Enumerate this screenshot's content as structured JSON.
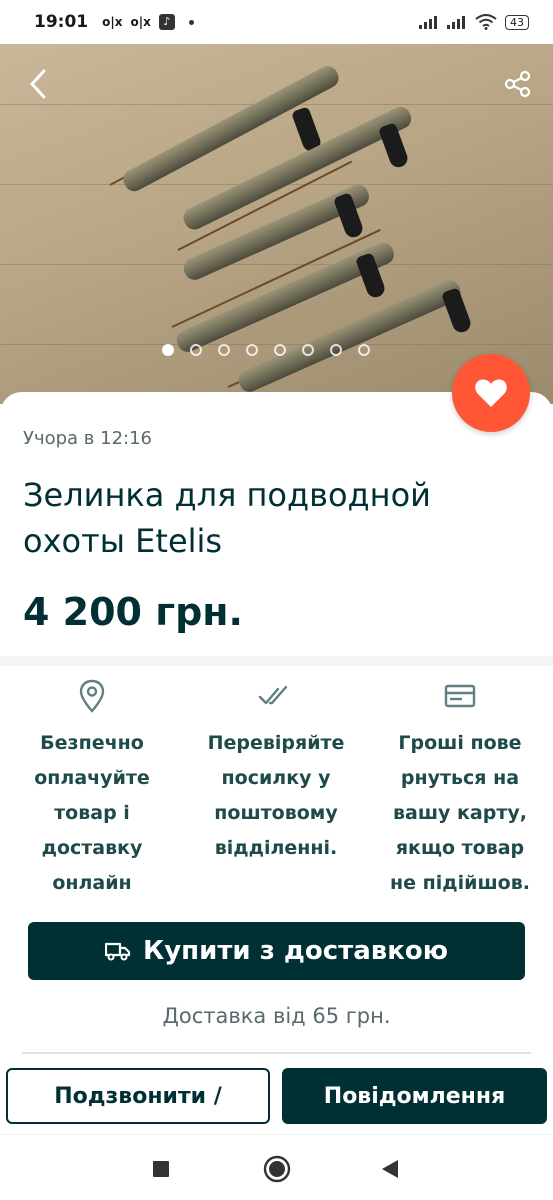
{
  "status_bar": {
    "time": "19:01",
    "notification_icons": [
      "olx-icon",
      "olx-icon",
      "music-app-icon",
      "dot-icon"
    ],
    "battery": "43"
  },
  "gallery": {
    "image_count": 8,
    "active_index": 0
  },
  "listing": {
    "posted": "Учора в 12:16",
    "title": "Зелинка для подводной охоты Etelis",
    "price": "4 200 грн."
  },
  "features": [
    {
      "icon": "location-pin-icon",
      "text": "Безпечно оплачуйте товар і доставку онлайн"
    },
    {
      "icon": "double-check-icon",
      "text": "Перевіряйте посилку у поштовому відділенні."
    },
    {
      "icon": "card-icon",
      "text": "Гроші пове рнуться на вашу карту, якщо товар не підійшов."
    }
  ],
  "actions": {
    "buy_with_delivery": "Купити з доставкою",
    "delivery_from": "Доставка від 65 грн.",
    "call": "Подзвонити /",
    "message": "Повідомлення"
  },
  "colors": {
    "primary": "#002f34",
    "favorite": "#ff5636"
  }
}
